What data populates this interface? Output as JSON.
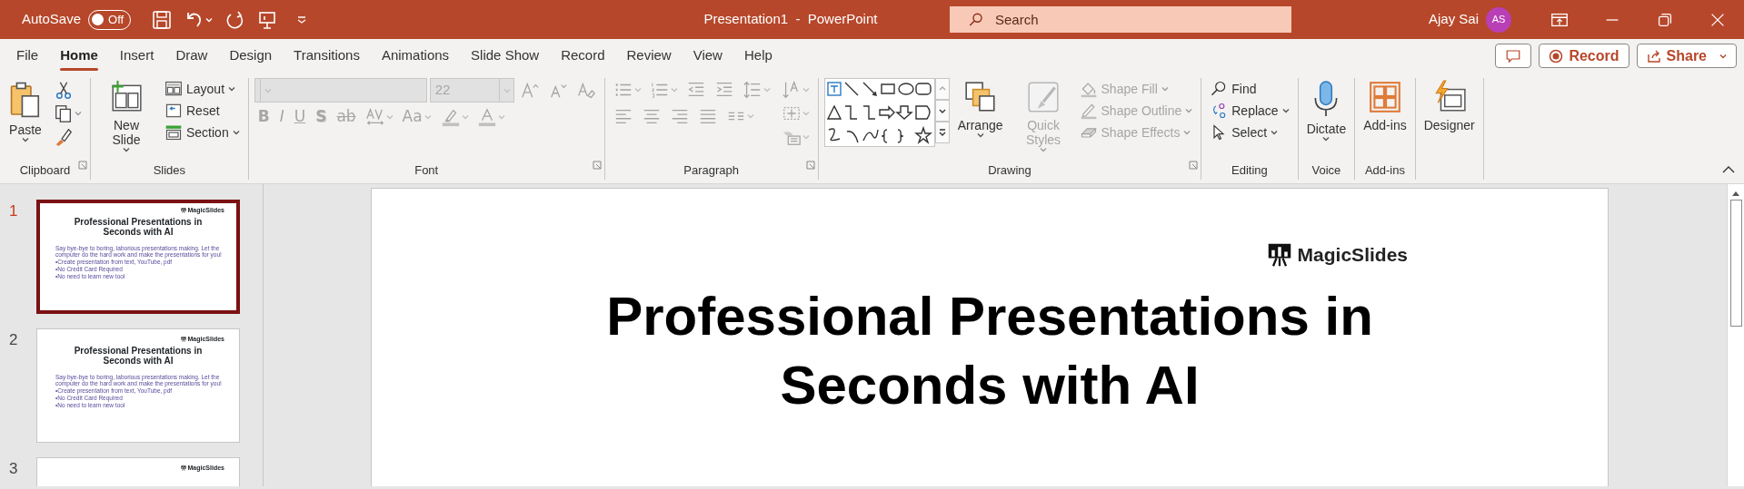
{
  "title_bar": {
    "autosave_label": "AutoSave",
    "autosave_toggle": {
      "label": "Off",
      "on": false
    },
    "document_title": "Presentation1  -  PowerPoint",
    "search": {
      "placeholder": "Search"
    },
    "user_name": "Ajay Sai",
    "avatar_initials": "AS"
  },
  "menu_tabs": [
    {
      "label": "File",
      "selected": false
    },
    {
      "label": "Home",
      "selected": true
    },
    {
      "label": "Insert",
      "selected": false
    },
    {
      "label": "Draw",
      "selected": false
    },
    {
      "label": "Design",
      "selected": false
    },
    {
      "label": "Transitions",
      "selected": false
    },
    {
      "label": "Animations",
      "selected": false
    },
    {
      "label": "Slide Show",
      "selected": false
    },
    {
      "label": "Record",
      "selected": false
    },
    {
      "label": "Review",
      "selected": false
    },
    {
      "label": "View",
      "selected": false
    },
    {
      "label": "Help",
      "selected": false
    }
  ],
  "header_buttons": [
    {
      "kind": "comments"
    },
    {
      "kind": "record",
      "label": "Record"
    },
    {
      "kind": "share",
      "label": "Share"
    }
  ],
  "ribbon_groups": [
    {
      "name": "Clipboard",
      "launcher": true,
      "columns": [
        [
          [
            {
              "kind": "large",
              "label": "Paste",
              "dropdown": true,
              "disabled": false
            }
          ]
        ],
        [
          [
            {
              "kind": "icon",
              "dropdown": false,
              "disabled": false
            }
          ],
          [
            {
              "kind": "icon",
              "dropdown": true,
              "disabled": false
            }
          ],
          [
            {
              "kind": "icon",
              "dropdown": false,
              "disabled": false
            }
          ]
        ]
      ]
    },
    {
      "name": "Slides",
      "columns": [
        [
          [
            {
              "kind": "large",
              "label": "New Slide",
              "dropdown": true,
              "disabled": false
            }
          ]
        ],
        [
          [
            {
              "kind": "small",
              "label": "Layout",
              "dropdown": true,
              "disabled": false
            }
          ],
          [
            {
              "kind": "small",
              "label": "Reset",
              "dropdown": false,
              "disabled": false
            }
          ],
          [
            {
              "kind": "small",
              "label": "Section",
              "dropdown": true,
              "disabled": false
            }
          ]
        ]
      ]
    },
    {
      "name": "Font",
      "launcher": true,
      "columns": [
        [
          [
            {
              "kind": "combo",
              "disabled": true
            },
            {
              "kind": "combo",
              "value": "22",
              "disabled": true
            },
            {
              "kind": "icon",
              "dropdown": false,
              "disabled": true
            },
            {
              "kind": "icon",
              "dropdown": false,
              "disabled": true
            },
            {
              "kind": "icon",
              "dropdown": false,
              "disabled": true
            }
          ],
          [
            {
              "kind": "glyph",
              "label": "B",
              "dropdown": false,
              "disabled": true
            },
            {
              "kind": "glyph",
              "label": "I",
              "dropdown": false,
              "disabled": true
            },
            {
              "kind": "glyph",
              "label": "U",
              "dropdown": false,
              "disabled": true
            },
            {
              "kind": "glyph",
              "label": "S",
              "dropdown": false,
              "disabled": true
            },
            {
              "kind": "glyph",
              "label": "ab",
              "dropdown": false,
              "disabled": true
            },
            {
              "kind": "icon",
              "dropdown": true,
              "disabled": true
            },
            {
              "kind": "glyph",
              "label": "Aa",
              "dropdown": true,
              "disabled": true
            },
            {
              "kind": "icon",
              "dropdown": true,
              "disabled": true
            },
            {
              "kind": "icon",
              "dropdown": true,
              "disabled": true
            }
          ]
        ]
      ]
    },
    {
      "name": "Paragraph",
      "launcher": true,
      "columns": [
        [
          [
            {
              "kind": "icon",
              "dropdown": true,
              "disabled": true
            },
            {
              "kind": "icon",
              "dropdown": true,
              "disabled": true
            },
            {
              "kind": "icon",
              "dropdown": false,
              "disabled": true
            },
            {
              "kind": "icon",
              "dropdown": false,
              "disabled": true
            },
            {
              "kind": "icon",
              "dropdown": true,
              "disabled": true
            }
          ],
          [
            {
              "kind": "icon",
              "dropdown": false,
              "disabled": true
            },
            {
              "kind": "icon",
              "dropdown": false,
              "disabled": true
            },
            {
              "kind": "icon",
              "dropdown": false,
              "disabled": true
            },
            {
              "kind": "icon",
              "dropdown": false,
              "disabled": true
            },
            {
              "kind": "icon",
              "dropdown": true,
              "disabled": true
            }
          ]
        ],
        [
          [
            {
              "kind": "icon",
              "dropdown": true,
              "disabled": true
            }
          ],
          [
            {
              "kind": "icon",
              "dropdown": true,
              "disabled": true
            }
          ],
          [
            {
              "kind": "icon",
              "dropdown": true,
              "disabled": true
            }
          ]
        ]
      ]
    },
    {
      "name": "Drawing",
      "launcher": true,
      "columns": [
        [
          [
            {
              "kind": "gallery"
            }
          ]
        ],
        [
          [
            {
              "kind": "large",
              "label": "Arrange",
              "dropdown": true,
              "disabled": false
            }
          ]
        ],
        [
          [
            {
              "kind": "large",
              "label": "Quick Styles",
              "dropdown": true,
              "disabled": true
            }
          ]
        ],
        [
          [
            {
              "kind": "small",
              "label": "Shape Fill",
              "dropdown": true,
              "disabled": true
            }
          ],
          [
            {
              "kind": "small",
              "label": "Shape Outline",
              "dropdown": true,
              "disabled": true
            }
          ],
          [
            {
              "kind": "small",
              "label": "Shape Effects",
              "dropdown": true,
              "disabled": true
            }
          ]
        ]
      ]
    },
    {
      "name": "Editing",
      "columns": [
        [
          [
            {
              "kind": "small",
              "label": "Find",
              "dropdown": false,
              "disabled": false
            }
          ],
          [
            {
              "kind": "small",
              "label": "Replace",
              "dropdown": true,
              "disabled": false
            }
          ],
          [
            {
              "kind": "small",
              "label": "Select",
              "dropdown": true,
              "disabled": false
            }
          ]
        ]
      ]
    },
    {
      "name": "Voice",
      "columns": [
        [
          [
            {
              "kind": "large",
              "label": "Dictate",
              "dropdown": true,
              "disabled": false
            }
          ]
        ]
      ]
    },
    {
      "name": "Add-ins",
      "columns": [
        [
          [
            {
              "kind": "large",
              "label": "Add-ins",
              "dropdown": false,
              "disabled": false
            }
          ]
        ]
      ]
    },
    {
      "columns": [
        [
          [
            {
              "kind": "large",
              "label": "Designer",
              "dropdown": false,
              "disabled": false
            }
          ]
        ]
      ]
    }
  ],
  "slides": [
    {
      "number": "1",
      "selected": true,
      "logo": "MagicSlides",
      "title": "Professional Presentations in Seconds with AI",
      "body": [
        "Say bye-bye to boring, laborious presentations making. Let the computer do the hard work and make the presentations for you!",
        "•Create presentation from text, YouTube, pdf",
        "•No Credit Card Required",
        "•No need to learn new tool"
      ]
    },
    {
      "number": "2",
      "selected": false,
      "logo": "MagicSlides",
      "title": "Professional Presentations in Seconds with AI",
      "body": [
        "Say bye-bye to boring, laborious presentations making. Let the computer do the hard work and make the presentations for you!",
        "•Create presentation from text, YouTube, pdf",
        "•No Credit Card Required",
        "•No need to learn new tool"
      ]
    },
    {
      "number": "3",
      "selected": false,
      "logo": "MagicSlides"
    }
  ],
  "current_slide": {
    "logo": "MagicSlides",
    "title_lines": [
      "Professional Presentations in",
      "Seconds with AI"
    ]
  }
}
